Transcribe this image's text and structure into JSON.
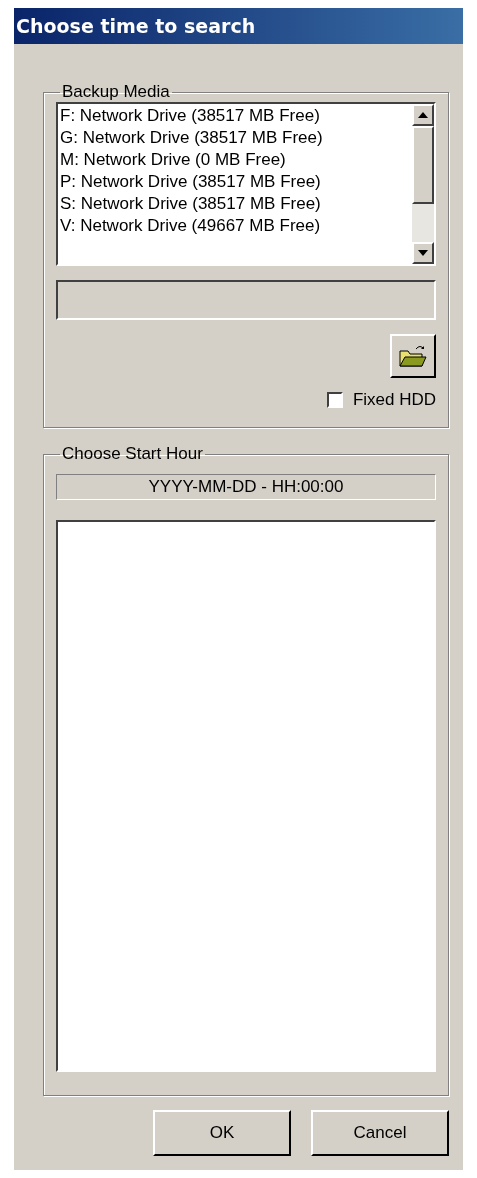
{
  "window": {
    "title": "Choose time to search"
  },
  "backup_media": {
    "label": "Backup Media",
    "drives": [
      {
        "text": "F: Network Drive (38517 MB Free)",
        "selected": false
      },
      {
        "text": "G: Network Drive (38517 MB Free)",
        "selected": false
      },
      {
        "text": "M: Network Drive (0 MB Free)",
        "selected": false
      },
      {
        "text": "P: Network Drive (38517 MB Free)",
        "selected": false
      },
      {
        "text": "S: Network Drive (38517 MB Free)",
        "selected": false
      },
      {
        "text": "V: Network Drive (49667 MB Free)",
        "selected": false
      }
    ],
    "fixed_hdd": {
      "label": "Fixed HDD",
      "checked": false
    }
  },
  "start_hour": {
    "label": "Choose Start Hour",
    "format": "YYYY-MM-DD - HH:00:00"
  },
  "buttons": [
    "OK",
    "Cancel"
  ]
}
